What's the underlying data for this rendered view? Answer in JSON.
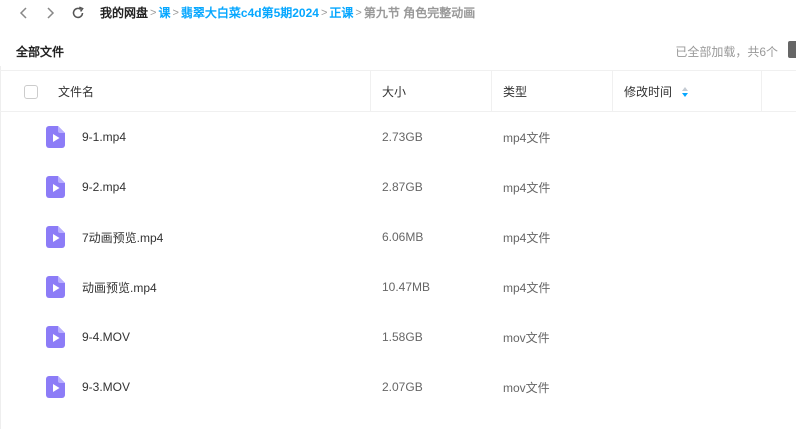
{
  "nav": {
    "back_icon": "chevron-left-icon",
    "forward_icon": "chevron-right-icon",
    "refresh_icon": "refresh-icon"
  },
  "breadcrumb": {
    "root": "我的网盘",
    "items": [
      "课",
      "翡翠大白菜c4d第5期2024",
      "正课"
    ],
    "current": "第九节 角色完整动画",
    "separator": ">"
  },
  "header": {
    "title": "全部文件",
    "status": "已全部加载，共6个"
  },
  "table": {
    "columns": {
      "name": "文件名",
      "size": "大小",
      "type": "类型",
      "modified": "修改时间"
    },
    "sort_icon": "sort-arrows-icon",
    "file_icon": "video-file-icon",
    "rows": [
      {
        "name": "9-1.mp4",
        "size": "2.73GB",
        "type": "mp4文件"
      },
      {
        "name": "9-2.mp4",
        "size": "2.87GB",
        "type": "mp4文件"
      },
      {
        "name": "7动画预览.mp4",
        "size": "6.06MB",
        "type": "mp4文件"
      },
      {
        "name": "动画预览.mp4",
        "size": "10.47MB",
        "type": "mp4文件"
      },
      {
        "name": "9-4.MOV",
        "size": "1.58GB",
        "type": "mov文件"
      },
      {
        "name": "9-3.MOV",
        "size": "2.07GB",
        "type": "mov文件"
      }
    ]
  },
  "colors": {
    "accent": "#06a7ff",
    "file_icon": "#8c7cf7",
    "muted": "#999999"
  }
}
